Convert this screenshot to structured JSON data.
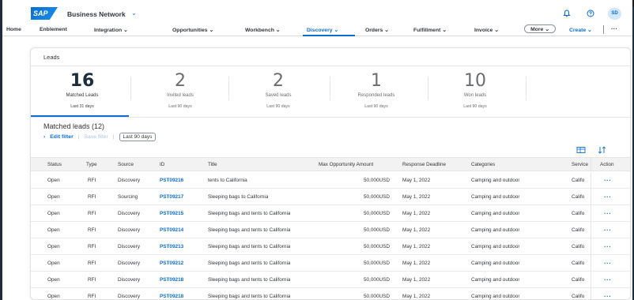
{
  "shell": {
    "logo": "SAP",
    "brand": "Business Network",
    "brand_chevron": "⌄",
    "icons": [
      "bell-icon",
      "help-icon"
    ],
    "avatar_initials": "SD"
  },
  "nav": {
    "items": [
      {
        "label": "Home"
      },
      {
        "label": "Enblement"
      },
      {
        "label": "Integration ⌄"
      },
      {
        "label": "Opportunities ⌄"
      },
      {
        "label": "Workbench ⌄"
      },
      {
        "label": "Discovery ⌄"
      },
      {
        "label": "Orders ⌄"
      },
      {
        "label": "Fulfillment ⌄"
      },
      {
        "label": "Invoice ⌄"
      }
    ],
    "active_index": 5,
    "more_label": "More ⌄",
    "create_label": "Create ⌄",
    "overflow_label": "···"
  },
  "leads": {
    "title": "Leads",
    "kpis": [
      {
        "value": "16",
        "label": "Matched Leads",
        "sub": "Last 31 days"
      },
      {
        "value": "2",
        "label": "Invited leads",
        "sub": "Last 90 days"
      },
      {
        "value": "2",
        "label": "Saved leads",
        "sub": "Last 90 days"
      },
      {
        "value": "1",
        "label": "Responded leads",
        "sub": "Last 90 days"
      },
      {
        "value": "10",
        "label": "Won leads",
        "sub": "Last 90 days"
      }
    ],
    "matched_title": "Matched leads (12)",
    "edit_filter": "Edit filter",
    "save_filter": "Save filter",
    "days_token": "Last 90 days",
    "table_icons": [
      "table-settings-icon",
      "sort-icon"
    ]
  },
  "table": {
    "headers": {
      "status": "Status",
      "type": "Type",
      "source": "Source",
      "id": "ID",
      "title": "Title",
      "amount": "Max Opportunity Amount",
      "deadline": "Response Deadline",
      "categories": "Categories",
      "service": "Service",
      "action": "Action"
    },
    "rows": [
      {
        "status": "Open",
        "type": "RFI",
        "source": "Discovery",
        "id": "PST09216",
        "title": "tents to California",
        "amount": "50,000USD",
        "deadline": "May 1, 2022",
        "categories": "Camping and outdoor",
        "service": "Califo",
        "action": "···"
      },
      {
        "status": "Open",
        "type": "RFI",
        "source": "Sourcing",
        "id": "PST09217",
        "title": "Sleeping bags to California",
        "amount": "50,000USD",
        "deadline": "May 1, 2022",
        "categories": "Camping and outdoor",
        "service": "Califo",
        "action": "···"
      },
      {
        "status": "Open",
        "type": "RFI",
        "source": "Discovery",
        "id": "PST09215",
        "title": "Sleeping bags and tents to California",
        "amount": "50,000USD",
        "deadline": "May 1, 2022",
        "categories": "Camping and outdoor",
        "service": "Califo",
        "action": "···"
      },
      {
        "status": "Open",
        "type": "RFI",
        "source": "Discovery",
        "id": "PST09214",
        "title": "Sleeping bags and tents to California",
        "amount": "50,000USD",
        "deadline": "May 1, 2022",
        "categories": "Camping and outdoor",
        "service": "Califo",
        "action": "···"
      },
      {
        "status": "Open",
        "type": "RFI",
        "source": "Discovery",
        "id": "PST09213",
        "title": "Sleeping bags and tents to California",
        "amount": "50,000USD",
        "deadline": "May 1, 2022",
        "categories": "Camping and outdoor",
        "service": "Califo",
        "action": "···"
      },
      {
        "status": "Open",
        "type": "RFI",
        "source": "Discovery",
        "id": "PST09212",
        "title": "Sleeping bags and tents to California",
        "amount": "50,000USD",
        "deadline": "May 1, 2022",
        "categories": "Camping and outdoor",
        "service": "Califo",
        "action": "···"
      },
      {
        "status": "Open",
        "type": "RFI",
        "source": "Discovery",
        "id": "PST09218",
        "title": "Sleeping bags and tents to California",
        "amount": "50,000USD",
        "deadline": "May 1, 2022",
        "categories": "Camping and outdoor",
        "service": "Califo",
        "action": "···"
      },
      {
        "status": "Open",
        "type": "RFI",
        "source": "Discovery",
        "id": "PST09218",
        "title": "Sleeping bags and tents to California",
        "amount": "50,000USD",
        "deadline": "May 1, 2022",
        "categories": "Camping and outdoor",
        "service": "Califo",
        "action": "···"
      }
    ]
  },
  "colors": {
    "accent": "#0a6ed1",
    "text": "#32363a",
    "header_bg": "#f2f2f2"
  }
}
